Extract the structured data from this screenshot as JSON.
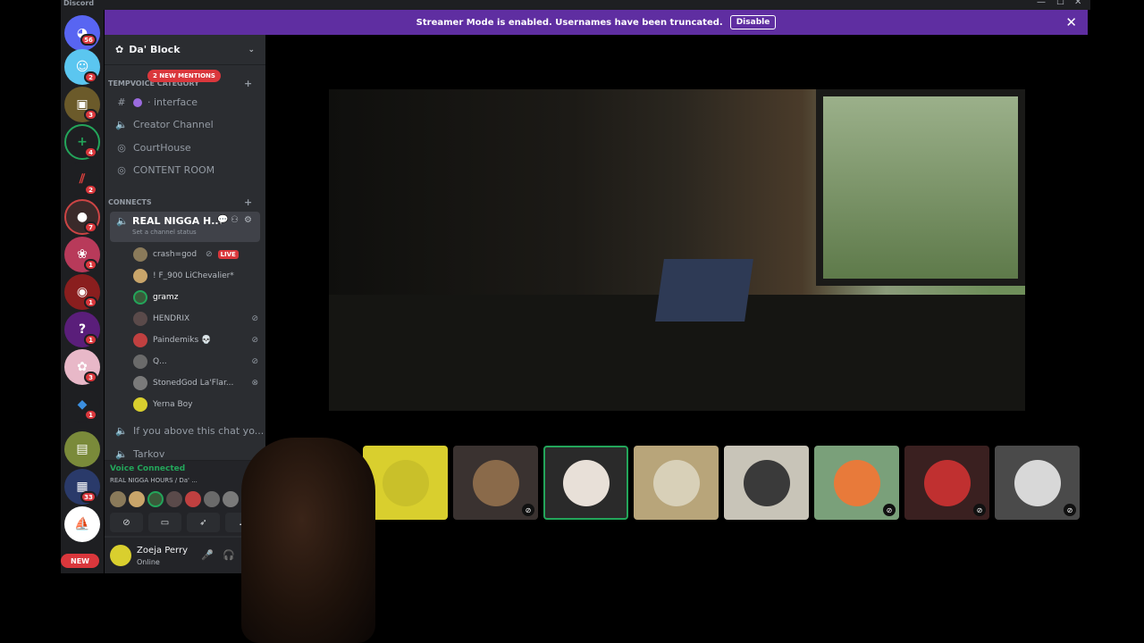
{
  "app": {
    "title": "Discord"
  },
  "window_controls": {
    "minimize": "—",
    "maximize": "☐",
    "close": "✕"
  },
  "banner": {
    "text": "Streamer Mode is enabled. Usernames have been truncated.",
    "button": "Disable",
    "close": "✕"
  },
  "guilds": {
    "badges": [
      "56",
      "2",
      "3",
      "4",
      "2",
      "7",
      "1",
      "1",
      "1",
      "3",
      "1",
      "33"
    ],
    "new_label": "NEW",
    "colors": {
      "mention_red": "#da373c",
      "blurple": "#5865f2",
      "online_green": "#23a55a"
    }
  },
  "server": {
    "name": "Da' Block",
    "mentions_pill": "2 NEW MENTIONS"
  },
  "categories": [
    {
      "label": "TEMPVOICE CATEGORY"
    },
    {
      "label": "CONNECTS"
    }
  ],
  "channels": [
    {
      "name": "· interface",
      "icon": "hash-icon"
    },
    {
      "name": "Creator Channel",
      "icon": "speaker-icon"
    },
    {
      "name": "CourtHouse",
      "icon": "stage-icon"
    },
    {
      "name": "CONTENT ROOM",
      "icon": "stage-icon"
    }
  ],
  "active_channel": {
    "name": "REAL NIGGA H...",
    "status": "Set a channel status"
  },
  "voice_users": [
    {
      "name": "crash=god",
      "badge": "LIVE"
    },
    {
      "name": "! F_900 LiChevalier*"
    },
    {
      "name": "gramz"
    },
    {
      "name": "HENDRIX"
    },
    {
      "name": "Paindemiks 💀"
    },
    {
      "name": "Q..."
    },
    {
      "name": "StonedGod La'Flar..."
    },
    {
      "name": "Yerna Boy"
    }
  ],
  "more_channels": [
    {
      "name": "If you above this chat yo..."
    },
    {
      "name": "Tarkov"
    }
  ],
  "voice_connection": {
    "status": "Voice Connected",
    "channel": "REAL NIGGA HOURS / Da' ..."
  },
  "user_panel": {
    "name": "Zoeja Perry",
    "status": "Online"
  }
}
